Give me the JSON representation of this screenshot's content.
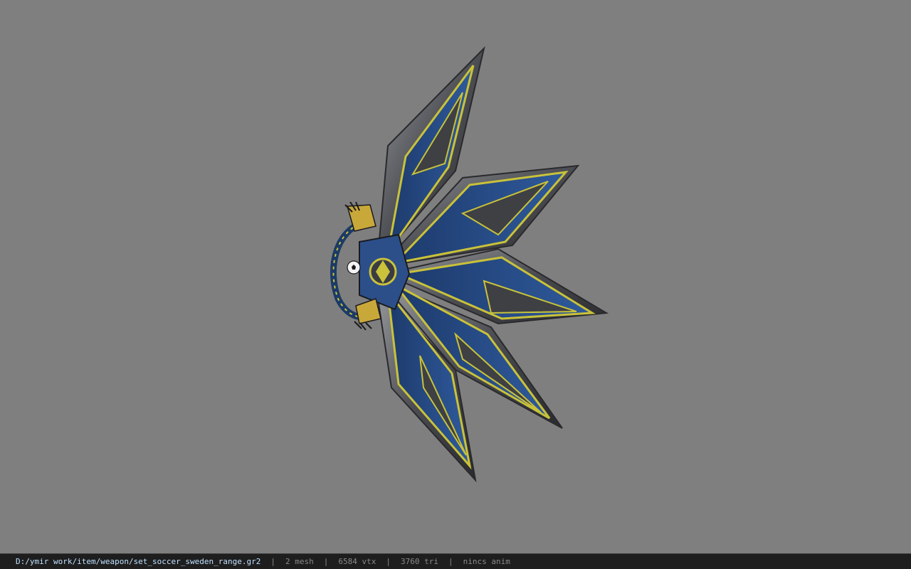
{
  "viewport": {
    "background": "#7f7f7f",
    "model": {
      "description_icon": "weapon-fan-model",
      "colors": {
        "blade_outer": "#4a4a4e",
        "blade_edge": "#b9bbbe",
        "blade_inner": "#2c4f8a",
        "trim": "#c9c23a",
        "handle": "#24426f",
        "ball": "#f2f2f2"
      }
    }
  },
  "status_bar": {
    "file_path": "D:/ymir work/item/weapon/set_soccer_sweden_range.gr2",
    "separator": "|",
    "mesh_count": "2 mesh",
    "vertex_count": "6584 vtx",
    "triangle_count": "3760 tri",
    "anim_state": "nincs anim",
    "path_color": "#bfe0ff",
    "muted_color": "#8a8a8a"
  }
}
